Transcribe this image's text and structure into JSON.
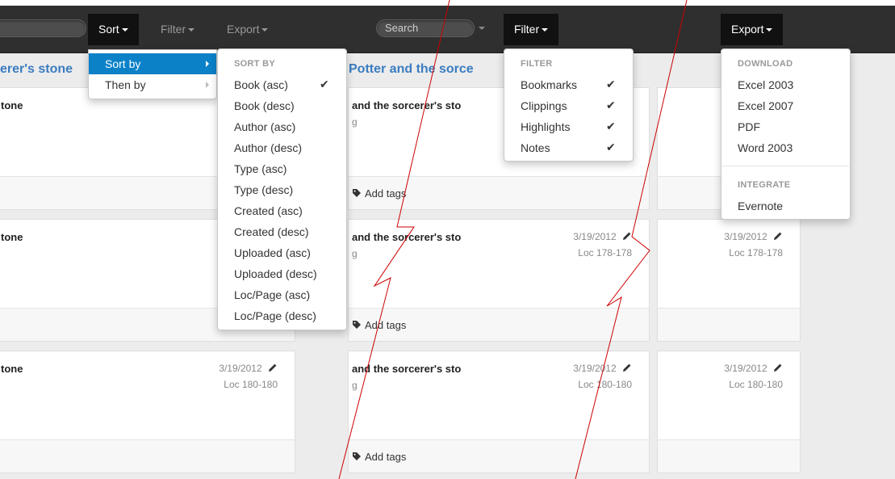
{
  "navbar": {
    "search_placeholder": "Search",
    "sort_label": "Sort",
    "filter_label": "Filter",
    "export_label": "Export"
  },
  "sections": {
    "left_title": "erer's stone",
    "middle_title": "Potter and the sorce"
  },
  "cards": {
    "left": [
      {
        "title": "tone",
        "date": "",
        "loc": ""
      },
      {
        "title": "tone",
        "date": "",
        "loc": ""
      },
      {
        "title": "tone",
        "date": "3/19/2012",
        "loc": "Loc 180-180"
      }
    ],
    "middle": [
      {
        "title": "and the sorcerer's sto",
        "sub": "g",
        "date": "",
        "loc": "",
        "tags": "Add tags"
      },
      {
        "title": "and the sorcerer's sto",
        "sub": "g",
        "date": "3/19/2012",
        "loc": "Loc 178-178",
        "tags": "Add tags"
      },
      {
        "title": "and the sorcerer's sto",
        "sub": "g",
        "date": "3/19/2012",
        "loc": "Loc 180-180",
        "tags": "Add tags"
      }
    ],
    "right": [
      {
        "date": "",
        "loc": ""
      },
      {
        "date": "3/19/2012",
        "loc": "Loc 178-178"
      },
      {
        "date": "3/19/2012",
        "loc": "Loc 180-180"
      }
    ]
  },
  "sort_menu": {
    "items": [
      "Sort by",
      "Then by"
    ],
    "submenu_header": "SORT BY",
    "options": [
      "Book (asc)",
      "Book (desc)",
      "Author (asc)",
      "Author (desc)",
      "Type (asc)",
      "Type (desc)",
      "Created (asc)",
      "Created (desc)",
      "Uploaded (asc)",
      "Uploaded (desc)",
      "Loc/Page (asc)",
      "Loc/Page (desc)"
    ],
    "checked": "Book (asc)"
  },
  "filter_menu": {
    "header": "FILTER",
    "options": [
      "Bookmarks",
      "Clippings",
      "Highlights",
      "Notes"
    ]
  },
  "export_menu": {
    "download_header": "DOWNLOAD",
    "download_options": [
      "Excel 2003",
      "Excel 2007",
      "PDF",
      "Word 2003"
    ],
    "integrate_header": "INTEGRATE",
    "integrate_options": [
      "Evernote"
    ]
  },
  "colors": {
    "navbar": "#2f2f2f",
    "active_menu": "#0b81c8",
    "title_link": "#3b7cc0",
    "annotation": "#cc0000"
  }
}
